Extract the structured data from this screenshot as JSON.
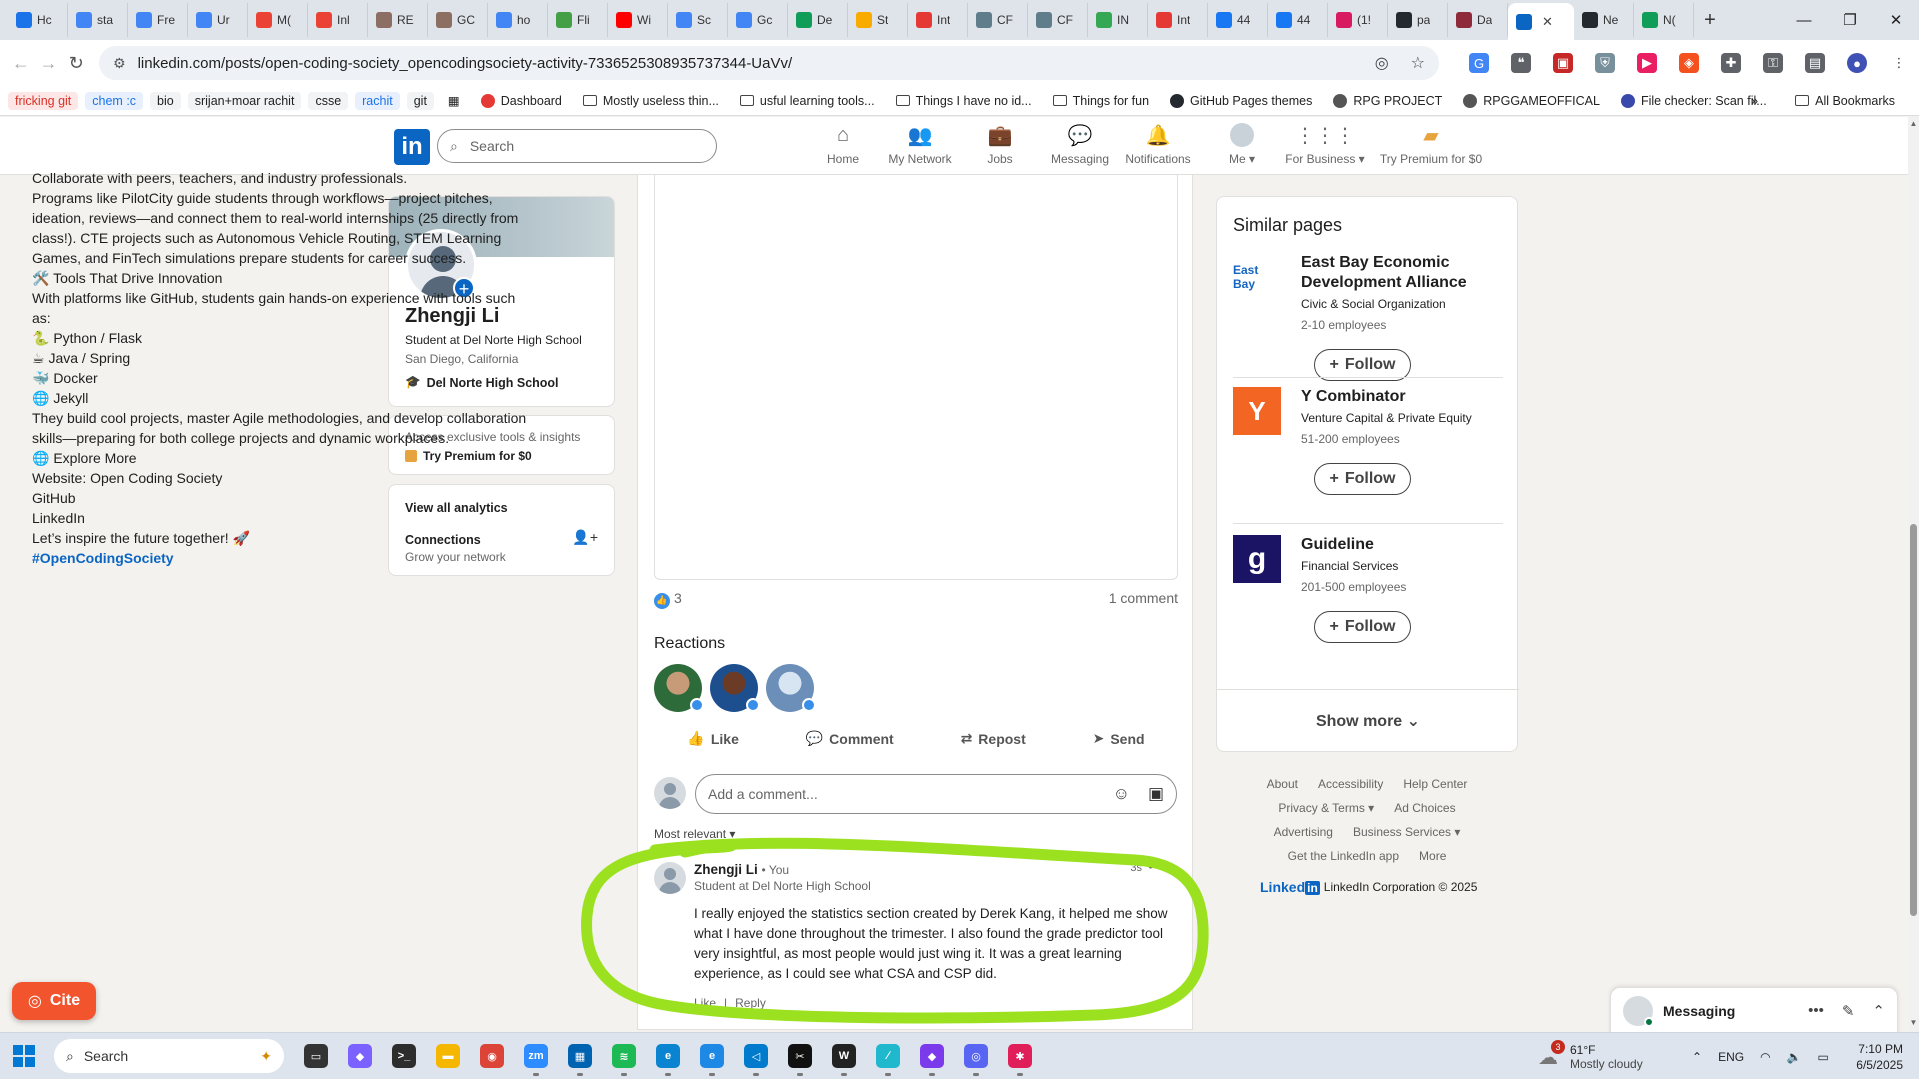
{
  "browser": {
    "tabs": [
      {
        "title": "Hc",
        "color": "#1a73e8"
      },
      {
        "title": "sta",
        "color": "#4285f4"
      },
      {
        "title": "Fre",
        "color": "#4285f4"
      },
      {
        "title": "Ur",
        "color": "#4285f4"
      },
      {
        "title": "M(",
        "color": "#ea4335"
      },
      {
        "title": "Inl",
        "color": "#ea4335"
      },
      {
        "title": "RE",
        "color": "#8d6e63"
      },
      {
        "title": "GC",
        "color": "#8d6e63"
      },
      {
        "title": "ho",
        "color": "#4285f4"
      },
      {
        "title": "Fli",
        "color": "#43a047"
      },
      {
        "title": "Wi",
        "color": "#ff0000"
      },
      {
        "title": "Sc",
        "color": "#4285f4"
      },
      {
        "title": "Gc",
        "color": "#4285f4"
      },
      {
        "title": "De",
        "color": "#0f9d58"
      },
      {
        "title": "St",
        "color": "#f9ab00"
      },
      {
        "title": "Int",
        "color": "#e53935"
      },
      {
        "title": "CF",
        "color": "#607d8b"
      },
      {
        "title": "CF",
        "color": "#607d8b"
      },
      {
        "title": "IN",
        "color": "#34a853"
      },
      {
        "title": "Int",
        "color": "#e53935"
      },
      {
        "title": "44",
        "color": "#1877f2"
      },
      {
        "title": "44",
        "color": "#1877f2"
      },
      {
        "title": "(1!",
        "color": "#d81b60"
      },
      {
        "title": "pa",
        "color": "#24292f"
      },
      {
        "title": "Da",
        "color": "#8e2a3a"
      },
      {
        "title": "",
        "color": "#0a66c2",
        "active": true
      },
      {
        "title": "Ne",
        "color": "#24292f"
      },
      {
        "title": "N(",
        "color": "#0f9d58"
      }
    ],
    "new_tab_icon": "+",
    "window_controls": [
      "—",
      "❐",
      "✕"
    ],
    "url": "linkedin.com/posts/open-coding-society_opencodingsociety-activity-7336525308935737344-UaVv/",
    "bookmarks": [
      {
        "label": "fricking git",
        "color": "#d93025",
        "bg": "#fde7e6"
      },
      {
        "label": "chem :c",
        "color": "#1a73e8",
        "bg": "#e8f0fe"
      },
      {
        "label": "bio",
        "color": "#222",
        "bg": "#f1f3f4"
      },
      {
        "label": "srijan+moar rachit",
        "color": "#222",
        "bg": "#f1f3f4"
      },
      {
        "label": "csse",
        "color": "#222",
        "bg": "#f1f3f4"
      },
      {
        "label": "rachit",
        "color": "#1a73e8",
        "bg": "#e8f0fe"
      },
      {
        "label": "git",
        "color": "#222",
        "bg": "#f1f3f4"
      }
    ],
    "bookmark_items": [
      {
        "label": "Dashboard",
        "type": "site",
        "color": "#e53935"
      },
      {
        "label": "Mostly useless thin...",
        "type": "folder"
      },
      {
        "label": "usful learning tools...",
        "type": "folder"
      },
      {
        "label": "Things I have no id...",
        "type": "folder"
      },
      {
        "label": "Things for fun",
        "type": "folder"
      },
      {
        "label": "GitHub Pages themes",
        "type": "site",
        "color": "#24292f"
      },
      {
        "label": "RPG PROJECT",
        "type": "site",
        "color": "#555"
      },
      {
        "label": "RPGGAMEOFFICAL",
        "type": "site",
        "color": "#555"
      },
      {
        "label": "File checker: Scan fil...",
        "type": "site",
        "color": "#3949ab"
      }
    ],
    "all_bookmarks": "All Bookmarks"
  },
  "linkedin_nav": {
    "logo": "in",
    "search_placeholder": "Search",
    "items": [
      {
        "label": "Home",
        "icon": "⌂"
      },
      {
        "label": "My Network",
        "icon": "👥"
      },
      {
        "label": "Jobs",
        "icon": "💼"
      },
      {
        "label": "Messaging",
        "icon": "💬"
      },
      {
        "label": "Notifications",
        "icon": "🔔"
      },
      {
        "label": "Me ▾",
        "icon": "●"
      },
      {
        "label": "For Business ▾",
        "icon": "⋮⋮⋮"
      },
      {
        "label": "Try Premium for $0",
        "icon": "▰"
      }
    ]
  },
  "profile": {
    "name": "Zhengji Li",
    "headline": "Student at Del Norte High School",
    "location": "San Diego, California",
    "school": "Del Norte High School",
    "premium_prompt": "Access exclusive tools & insights",
    "premium_cta": "Try Premium for $0",
    "analytics": "View all analytics",
    "connections": "Connections",
    "grow": "Grow your network"
  },
  "post": {
    "lines": [
      "Collaborate with peers, teachers, and industry professionals.",
      "Programs like PilotCity guide students through workflows—project pitches,",
      "ideation, reviews—and connect them to real-world internships (25 directly from",
      "class!). CTE projects such as Autonomous Vehicle Routing, STEM Learning",
      "Games, and FinTech simulations prepare students for career success.",
      "🛠️ Tools That Drive Innovation",
      " With platforms like GitHub, students gain hands-on experience with tools such",
      "as:",
      "🐍 Python / Flask",
      "☕ Java / Spring",
      "🐳 Docker",
      "🌐 Jekyll",
      "They build cool projects, master Agile methodologies, and develop collaboration",
      "skills—preparing for both college projects and dynamic workplaces.",
      "🌐 Explore More",
      " Website: Open Coding Society",
      " GitHub",
      " LinkedIn",
      "Let’s inspire the future together! 🚀"
    ],
    "hashtag": "#OpenCodingSociety",
    "reaction_count": "3",
    "comment_count": "1 comment",
    "reactions_title": "Reactions",
    "actions": {
      "like": "Like",
      "comment": "Comment",
      "repost": "Repost",
      "send": "Send"
    },
    "comment_placeholder": "Add a comment...",
    "sort_label": "Most relevant ▾"
  },
  "comment": {
    "author": "Zhengji Li",
    "you": "• You",
    "headline": "Student at Del Norte High School",
    "time": "3s",
    "text": "I really enjoyed the statistics section created by Derek Kang, it helped me show what I have done throughout the trimester. I also found the grade predictor tool very insightful, as most people would just wing it. It was a great learning experience, as I could see what CSA and CSP did.",
    "like": "Like",
    "reply": "Reply"
  },
  "similar_pages": {
    "title": "Similar pages",
    "companies": [
      {
        "name": "East Bay Economic Development Alliance",
        "industry": "Civic & Social Organization",
        "size": "2-10 employees",
        "logo_text": "East Bay",
        "logo_color": "#1565c0",
        "logo_bg": "#ffffff"
      },
      {
        "name": "Y Combinator",
        "industry": "Venture Capital & Private Equity",
        "size": "51-200 employees",
        "logo_text": "Y",
        "logo_color": "#ffffff",
        "logo_bg": "#f26522"
      },
      {
        "name": "Guideline",
        "industry": "Financial Services",
        "size": "201-500 employees",
        "logo_text": "g",
        "logo_color": "#ffffff",
        "logo_bg": "#1b1464"
      }
    ],
    "follow_label": "Follow",
    "show_more": "Show more"
  },
  "footer": {
    "row1": [
      "About",
      "Accessibility",
      "Help Center"
    ],
    "row2": [
      "Privacy & Terms ▾",
      "Ad Choices"
    ],
    "row3": [
      "Advertising",
      "Business Services ▾"
    ],
    "row4": [
      "Get the LinkedIn app",
      "More"
    ],
    "copyright": "LinkedIn Corporation © 2025",
    "wordmark": "Linked"
  },
  "cite": {
    "label": "Cite"
  },
  "messaging": {
    "label": "Messaging"
  },
  "taskbar": {
    "search": "Search",
    "apps": [
      {
        "name": "task-view",
        "color": "#333",
        "glyph": "▭"
      },
      {
        "name": "copilot",
        "color": "#7b61ff",
        "glyph": "◆"
      },
      {
        "name": "terminal",
        "color": "#2d2d2d",
        "glyph": ">_"
      },
      {
        "name": "file-explorer",
        "color": "#f5b700",
        "glyph": "▬"
      },
      {
        "name": "chrome",
        "color": "#db4437",
        "glyph": "◉",
        "active": true
      },
      {
        "name": "zoom",
        "color": "#2d8cff",
        "glyph": "zm"
      },
      {
        "name": "store",
        "color": "#0063b1",
        "glyph": "▦"
      },
      {
        "name": "spotify",
        "color": "#1db954",
        "glyph": "≋"
      },
      {
        "name": "edge",
        "color": "#0a84d0",
        "glyph": "e"
      },
      {
        "name": "edge-dev",
        "color": "#1e88e5",
        "glyph": "e"
      },
      {
        "name": "vscode",
        "color": "#007acc",
        "glyph": "◁"
      },
      {
        "name": "capcut",
        "color": "#111",
        "glyph": "✂"
      },
      {
        "name": "wattpad",
        "color": "#222",
        "glyph": "W"
      },
      {
        "name": "perplexity",
        "color": "#20b8cd",
        "glyph": "∕"
      },
      {
        "name": "obsidian",
        "color": "#7c3aed",
        "glyph": "◆"
      },
      {
        "name": "discord",
        "color": "#5865f2",
        "glyph": "◎"
      },
      {
        "name": "slack",
        "color": "#e01e5a",
        "glyph": "✱"
      }
    ],
    "weather_badge": "3",
    "temp": "61°F",
    "condition": "Mostly cloudy",
    "lang": "ENG",
    "time": "7:10 PM",
    "date": "6/5/2025"
  }
}
